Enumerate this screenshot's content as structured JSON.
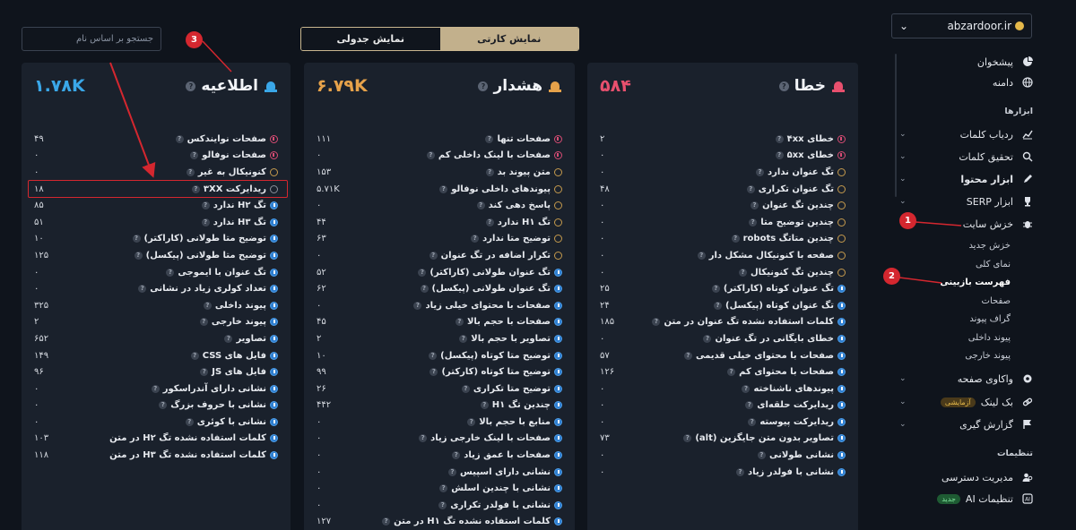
{
  "search": {
    "placeholder": "جستجو بر اساس نام"
  },
  "view_toggle": {
    "card_label": "نمایش کارتی",
    "table_label": "نمایش جدولی"
  },
  "cards": {
    "error": {
      "title": "خطا",
      "count": "۵۸۴",
      "color": "#e8506e",
      "rows": [
        {
          "label": "خطای ۴xx",
          "value": "۲",
          "dot": "red",
          "help": true
        },
        {
          "label": "خطای ۵xx",
          "value": "۰",
          "dot": "red",
          "help": true
        },
        {
          "label": "تگ عنوان ندارد",
          "value": "۰",
          "dot": "orange",
          "help": true
        },
        {
          "label": "تگ عنوان تکراری",
          "value": "۴۸",
          "dot": "orange",
          "help": true
        },
        {
          "label": "چندین تگ عنوان",
          "value": "۰",
          "dot": "orange",
          "help": true
        },
        {
          "label": "چندین توضیح متا",
          "value": "۰",
          "dot": "orange",
          "help": true
        },
        {
          "label": "چندین متاتگ robots",
          "value": "۰",
          "dot": "orange",
          "help": true
        },
        {
          "label": "صفحه با کنونیکال مشکل دار",
          "value": "۰",
          "dot": "orange",
          "help": true
        },
        {
          "label": "چندین تگ کنونیکال",
          "value": "۰",
          "dot": "orange",
          "help": true
        },
        {
          "label": "تگ عنوان کوتاه (کاراکتر)",
          "value": "۲۵",
          "dot": "blue",
          "help": true
        },
        {
          "label": "تگ عنوان کوتاه (پیکسل)",
          "value": "۲۴",
          "dot": "blue",
          "help": true
        },
        {
          "label": "کلمات استفاده نشده تگ عنوان در متن",
          "value": "۱۸۵",
          "dot": "blue",
          "help": true
        },
        {
          "label": "خطای بایگانی در تگ عنوان",
          "value": "۰",
          "dot": "blue",
          "help": true
        },
        {
          "label": "صفحات با محتوای خیلی قدیمی",
          "value": "۵۷",
          "dot": "blue",
          "help": true
        },
        {
          "label": "صفحات با محتوای کم",
          "value": "۱۲۶",
          "dot": "blue",
          "help": true
        },
        {
          "label": "پیوندهای ناشناخته",
          "value": "۰",
          "dot": "blue",
          "help": true
        },
        {
          "label": "ریدایرکت حلقه‌ای",
          "value": "۰",
          "dot": "blue",
          "help": true
        },
        {
          "label": "ریدایرکت پیوسته",
          "value": "۰",
          "dot": "blue",
          "help": true
        },
        {
          "label": "تصاویر بدون متن جایگزین (alt)",
          "value": "۷۳",
          "dot": "blue",
          "help": true
        },
        {
          "label": "نشانی طولانی",
          "value": "۰",
          "dot": "blue",
          "help": true
        },
        {
          "label": "نشانی با فولدر زیاد",
          "value": "۰",
          "dot": "blue",
          "help": true
        }
      ]
    },
    "warning": {
      "title": "هشدار",
      "count": "۶.۷۹K",
      "color": "#e6a24a",
      "rows": [
        {
          "label": "صفحات تنها",
          "value": "۱۱۱",
          "dot": "red",
          "help": true
        },
        {
          "label": "صفحات با لینک داخلی کم",
          "value": "۰",
          "dot": "red",
          "help": true
        },
        {
          "label": "متن پیوند بد",
          "value": "۱۵۳",
          "dot": "orange",
          "help": true
        },
        {
          "label": "پیوندهای داخلی نوفالو",
          "value": "۵.۷۱K",
          "dot": "orange",
          "help": true
        },
        {
          "label": "پاسخ دهی کند",
          "value": "۰",
          "dot": "orange",
          "help": true
        },
        {
          "label": "تگ H۱ ندارد",
          "value": "۴۴",
          "dot": "orange",
          "help": true
        },
        {
          "label": "توضیح متا ندارد",
          "value": "۶۳",
          "dot": "orange",
          "help": true
        },
        {
          "label": "تکرار اضافه در تگ عنوان",
          "value": "۰",
          "dot": "orange",
          "help": true
        },
        {
          "label": "تگ عنوان طولانی (کاراکتر)",
          "value": "۵۲",
          "dot": "blue",
          "help": true
        },
        {
          "label": "تگ عنوان طولانی (پیکسل)",
          "value": "۶۲",
          "dot": "blue",
          "help": true
        },
        {
          "label": "صفحات با محتوای خیلی زیاد",
          "value": "۰",
          "dot": "blue",
          "help": true
        },
        {
          "label": "صفحات با حجم بالا",
          "value": "۴۵",
          "dot": "blue",
          "help": true
        },
        {
          "label": "تصاویر با حجم بالا",
          "value": "۲",
          "dot": "blue",
          "help": true
        },
        {
          "label": "توضیح متا کوتاه (پیکسل)",
          "value": "۱۰",
          "dot": "blue",
          "help": true
        },
        {
          "label": "توضیح متا کوتاه (کارکتر)",
          "value": "۹۹",
          "dot": "blue",
          "help": true
        },
        {
          "label": "توضیح متا تکراری",
          "value": "۲۶",
          "dot": "blue",
          "help": true
        },
        {
          "label": "چندین تگ H۱",
          "value": "۴۴۲",
          "dot": "blue",
          "help": true
        },
        {
          "label": "منابع با حجم بالا",
          "value": "۰",
          "dot": "blue",
          "help": true
        },
        {
          "label": "صفحات با لینک خارجی زیاد",
          "value": "۰",
          "dot": "blue",
          "help": true
        },
        {
          "label": "صفحات با عمق زیاد",
          "value": "۰",
          "dot": "blue",
          "help": true
        },
        {
          "label": "نشانی دارای اسپیس",
          "value": "۰",
          "dot": "blue",
          "help": true
        },
        {
          "label": "نشانی با چندین اسلش",
          "value": "۰",
          "dot": "blue",
          "help": true
        },
        {
          "label": "نشانی با فولدر تکراری",
          "value": "۰",
          "dot": "blue",
          "help": true
        },
        {
          "label": "کلمات استفاده نشده تگ H۱ در متن",
          "value": "۱۲۷",
          "dot": "blue",
          "help": true
        }
      ]
    },
    "info": {
      "title": "اطلاعیه",
      "count": "۱.۷۸K",
      "color": "#3aa7e8",
      "rows": [
        {
          "label": "صفحات نوایندکس",
          "value": "۴۹",
          "dot": "red",
          "help": true
        },
        {
          "label": "صفحات نوفالو",
          "value": "۰",
          "dot": "red",
          "help": true
        },
        {
          "label": "کنونیکال به غیر",
          "value": "۰",
          "dot": "orange",
          "help": true
        },
        {
          "label": "ریدایرکت ۳XX",
          "value": "۱۸",
          "dot": "gray",
          "help": true
        },
        {
          "label": "تگ H۲ ندارد",
          "value": "۸۵",
          "dot": "blue",
          "help": true
        },
        {
          "label": "تگ H۳ ندارد",
          "value": "۵۱",
          "dot": "blue",
          "help": true
        },
        {
          "label": "توضیح متا طولانی (کاراکتر)",
          "value": "۱۰",
          "dot": "blue",
          "help": true
        },
        {
          "label": "توضیح متا طولانی (پیکسل)",
          "value": "۱۲۵",
          "dot": "blue",
          "help": true
        },
        {
          "label": "تگ عنوان با ایموجی",
          "value": "۰",
          "dot": "blue",
          "help": true
        },
        {
          "label": "تعداد کولری زیاد در نشانی",
          "value": "۰",
          "dot": "blue",
          "help": true
        },
        {
          "label": "پیوند داخلی",
          "value": "۳۲۵",
          "dot": "blue",
          "help": true
        },
        {
          "label": "پیوند خارجی",
          "value": "۲",
          "dot": "blue",
          "help": true
        },
        {
          "label": "تصاویر",
          "value": "۶۵۲",
          "dot": "blue",
          "help": true
        },
        {
          "label": "فایل های CSS",
          "value": "۱۴۹",
          "dot": "blue",
          "help": true
        },
        {
          "label": "فایل های JS",
          "value": "۹۶",
          "dot": "blue",
          "help": true
        },
        {
          "label": "نشانی دارای آندراسکور",
          "value": "۰",
          "dot": "blue",
          "help": true
        },
        {
          "label": "نشانی با حروف بزرگ",
          "value": "۰",
          "dot": "blue",
          "help": true
        },
        {
          "label": "نشانی با کوئری",
          "value": "۰",
          "dot": "blue",
          "help": true
        },
        {
          "label": "کلمات استفاده نشده تگ H۲ در متن",
          "value": "۱۰۳",
          "dot": "blue",
          "help": false
        },
        {
          "label": "کلمات استفاده نشده تگ H۳ در متن",
          "value": "۱۱۸",
          "dot": "blue",
          "help": false
        }
      ]
    }
  },
  "sidebar": {
    "domain": "abzardoor.ir",
    "items": [
      {
        "label": "پیشخوان",
        "icon": "pie-chart-icon"
      },
      {
        "label": "دامنه",
        "icon": "globe-icon"
      }
    ],
    "tools_heading": "ابزارها",
    "tools": [
      {
        "label": "ردیاب کلمات",
        "icon": "trend-chart-icon",
        "chevron": true
      },
      {
        "label": "تحقیق کلمات",
        "icon": "search-icon",
        "chevron": true
      },
      {
        "label": "ابزار محتوا",
        "icon": "pen-icon",
        "chevron": true,
        "bold": true
      },
      {
        "label": "ابزار SERP",
        "icon": "trophy-icon",
        "chevron": true
      },
      {
        "label": "خزش سایت",
        "icon": "bug-icon",
        "chevron": true
      }
    ],
    "crawl_sub": [
      "خزش جدید",
      "نمای کلی",
      "فهرست بازبینی",
      "صفحات",
      "گراف پیوند",
      "پیوند داخلی",
      "پیوند خارجی"
    ],
    "more_tools": [
      {
        "label": "واکاوی صفحه",
        "icon": "gear-icon",
        "chevron": true
      },
      {
        "label": "بک لینک",
        "icon": "link-icon",
        "chevron": true,
        "pill": "آزمایشی"
      },
      {
        "label": "گزارش گیری",
        "icon": "flag-icon",
        "chevron": true
      }
    ],
    "settings_heading": "تنظیمات",
    "settings": [
      {
        "label": "مدیریت دسترسی",
        "icon": "users-icon"
      },
      {
        "label": "تنظیمات AI",
        "icon": "ai-icon",
        "pill": "جدید"
      }
    ]
  },
  "annotations": {
    "badge_1": "1",
    "badge_2": "2",
    "badge_3": "3"
  }
}
